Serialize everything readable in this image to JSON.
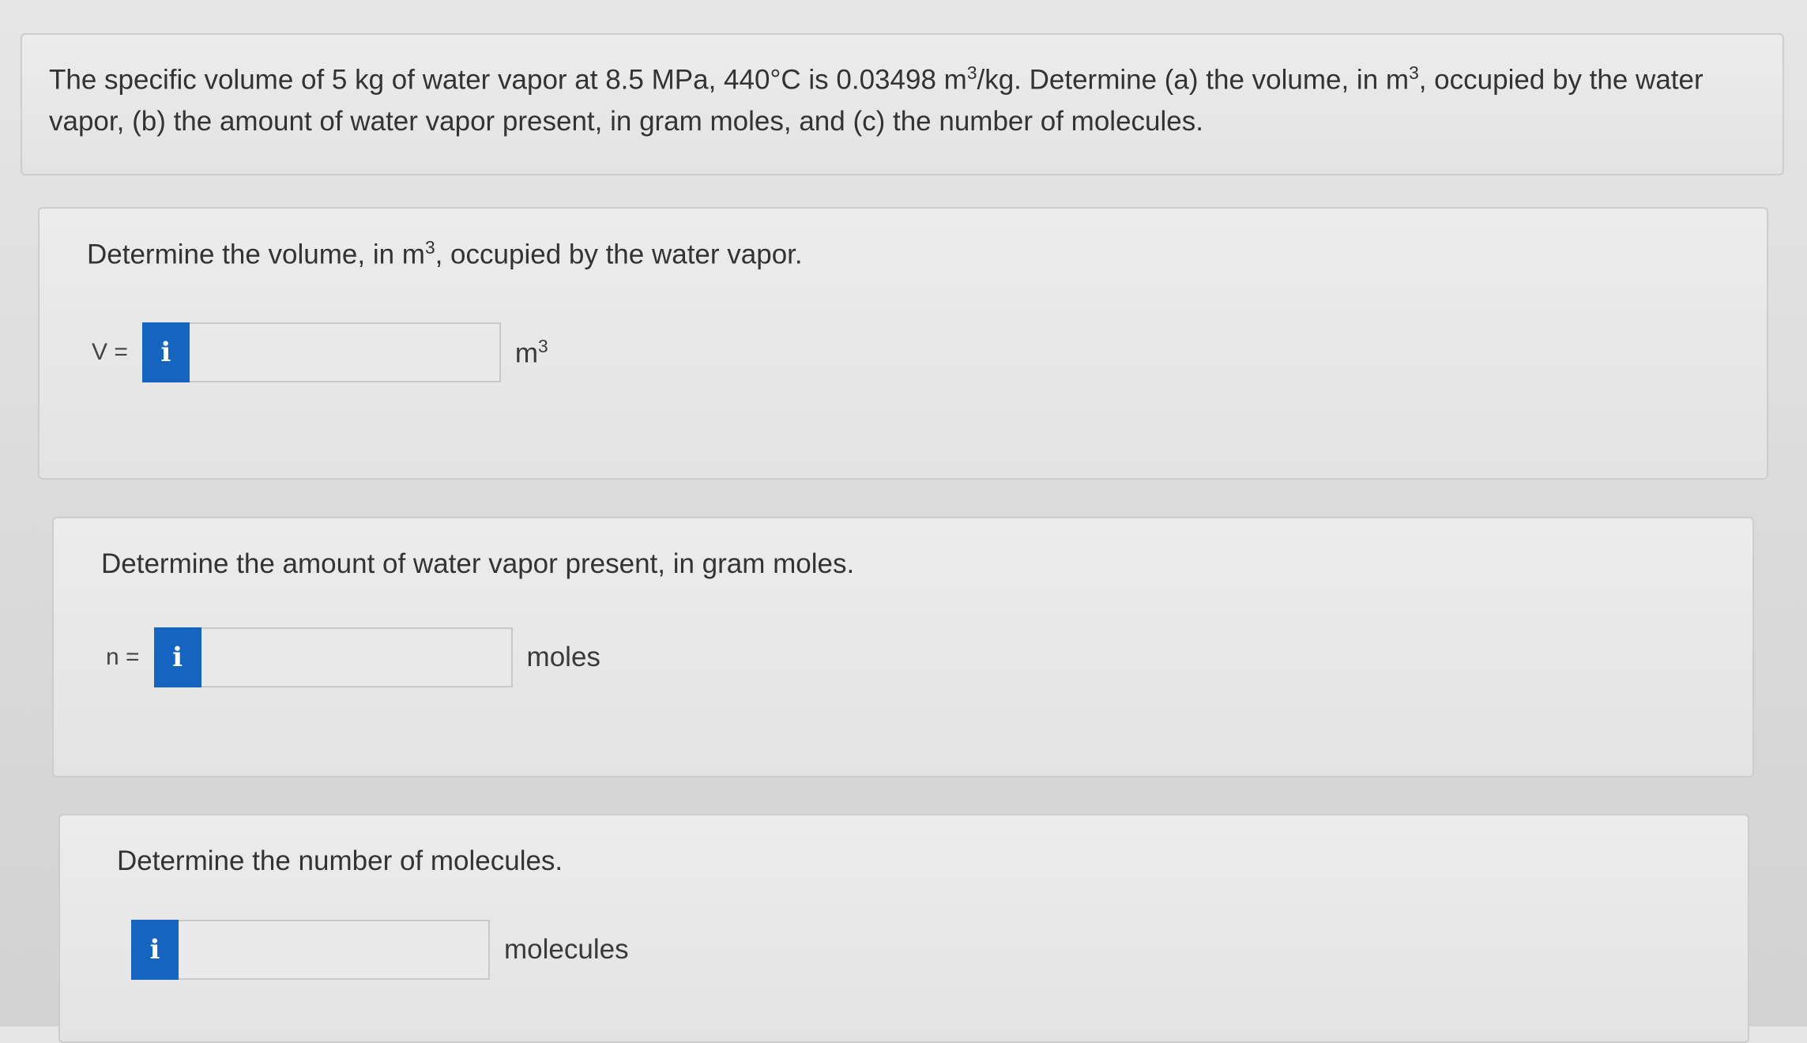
{
  "problem": {
    "text_1": "The specific volume of 5 kg of water vapor at 8.5 MPa, 440°C is 0.03498 m",
    "sup_1": "3",
    "text_2": "/kg. Determine (a) the volume, in m",
    "sup_2": "3",
    "text_3": ", occupied by the water vapor, (b) the amount of water vapor present, in gram moles, and (c) the number of molecules."
  },
  "part_a": {
    "prompt_1": "Determine the volume, in m",
    "prompt_sup": "3",
    "prompt_2": ", occupied by the water vapor.",
    "var_label": "V =",
    "info_label": "i",
    "input_value": "",
    "unit": "m",
    "unit_sup": "3"
  },
  "part_b": {
    "prompt": "Determine the amount of water vapor present, in gram moles.",
    "var_label": "n =",
    "info_label": "i",
    "input_value": "",
    "unit": "moles"
  },
  "part_c": {
    "prompt": "Determine the number of molecules.",
    "info_label": "i",
    "input_value": "",
    "unit": "molecules"
  },
  "colors": {
    "info_button": "#1565c0",
    "background": "#dcdcdc",
    "card": "#e8e8e8"
  },
  "icons": {
    "info": "info-icon"
  }
}
